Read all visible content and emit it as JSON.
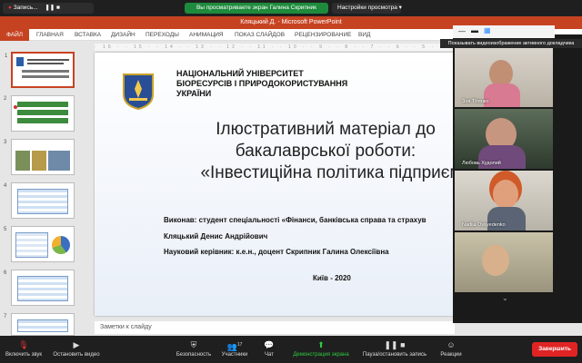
{
  "zoom_top": {
    "recording_label": "Запись...",
    "share_note": "Вы просматриваете экран Галина Скрипник",
    "view_options": "Настройки просмотра"
  },
  "window": {
    "title": "Кляцький Д. - Microsoft PowerPoint"
  },
  "ribbon": {
    "tabs": [
      "ФАЙЛ",
      "ГЛАВНАЯ",
      "ВСТАВКА",
      "ДИЗАЙН",
      "ПЕРЕХОДЫ",
      "АНИМАЦИЯ",
      "ПОКАЗ СЛАЙДОВ",
      "РЕЦЕНЗИРОВАНИЕ",
      "ВИД"
    ]
  },
  "ruler_text": "· 16 · · 15 · · 14 · · 13 · · 12 · · 11 · · 10 · · 9 · · 8 · · 7 · · 6 · · 5 · · 4 · · 3 · · 2 · · 1 · · 0 · · 1 · · 2 · · 3",
  "thumbnails": [
    "1",
    "2",
    "3",
    "4",
    "5",
    "6",
    "7"
  ],
  "slide": {
    "university": [
      "НАЦІОНАЛЬНИЙ УНІВЕРСИТЕТ",
      "БІОРЕСУРСІВ І ПРИРОДОКОРИСТУВАННЯ",
      "УКРАЇНИ"
    ],
    "title": [
      "Ілюстративний матеріал до",
      "бакалаврської роботи:",
      "«Інвестиційна політика підприєм"
    ],
    "author_line": "Виконав: студент спеціальності «Фінанси, банківська справа та страхув",
    "author_name": "Кляцький  Денис Андрійович",
    "supervisor": "Науковий керівник: к.е.н., доцент Скрипник Галина Олексіївна",
    "city_year": "Київ - 2020"
  },
  "notes_placeholder": "Заметки к слайду",
  "gallery": {
    "tooltip": "Показывать видеоизображение активного докладчика",
    "participants": [
      "Зоя Тітенко",
      "Любовь Худолий",
      "Nadiia Ovsyedenko",
      ""
    ]
  },
  "bottom_bar": {
    "mute": "Включить звук",
    "video": "Остановить видео",
    "security": "Безопасность",
    "participants": "Участники",
    "participants_count": "17",
    "chat": "Чат",
    "share": "Демонстрация экрана",
    "record": "Паузa/остановить запись",
    "reactions": "Реакции",
    "end": "Завершить"
  }
}
